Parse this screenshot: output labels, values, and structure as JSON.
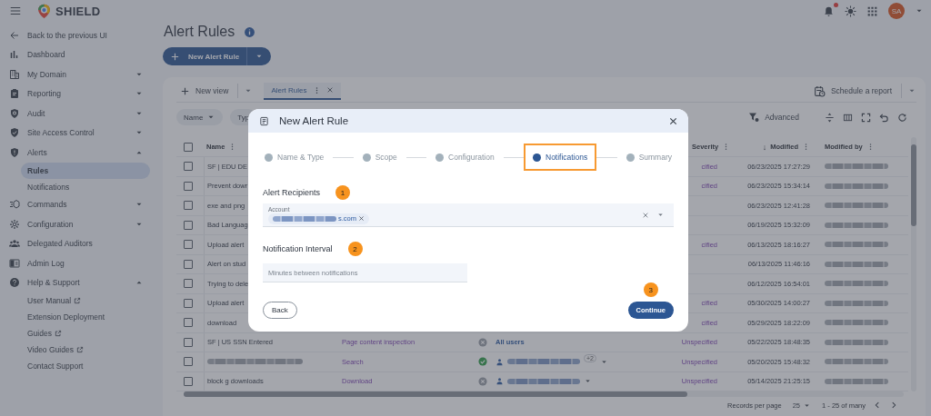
{
  "app": {
    "title": "SHIELD",
    "avatar": "SA"
  },
  "sidebar": {
    "items": [
      {
        "label": "Back to the previous UI",
        "kind": "back",
        "selected": false
      },
      {
        "label": "Dashboard",
        "kind": "link",
        "selected": false
      },
      {
        "label": "My Domain",
        "kind": "group",
        "selected": false,
        "expanded": false
      },
      {
        "label": "Reporting",
        "kind": "group",
        "selected": false,
        "expanded": false
      },
      {
        "label": "Audit",
        "kind": "group",
        "selected": false,
        "expanded": false
      },
      {
        "label": "Site Access Control",
        "kind": "group",
        "selected": false,
        "expanded": false
      },
      {
        "label": "Alerts",
        "kind": "group",
        "selected": false,
        "expanded": true,
        "children": [
          {
            "label": "Rules",
            "selected": true,
            "external": false
          },
          {
            "label": "Notifications",
            "selected": false,
            "external": false
          }
        ]
      },
      {
        "label": "Commands",
        "kind": "group",
        "selected": false,
        "expanded": false
      },
      {
        "label": "Configuration",
        "kind": "group",
        "selected": false,
        "expanded": false
      },
      {
        "label": "Delegated Auditors",
        "kind": "link",
        "selected": false
      },
      {
        "label": "Admin Log",
        "kind": "link",
        "selected": false
      },
      {
        "label": "Help & Support",
        "kind": "group",
        "selected": false,
        "expanded": true,
        "children": [
          {
            "label": "User Manual",
            "selected": false,
            "external": true
          },
          {
            "label": "Extension Deployment",
            "selected": false,
            "external": false
          },
          {
            "label": "Guides",
            "selected": false,
            "external": true
          },
          {
            "label": "Video Guides",
            "selected": false,
            "external": true
          },
          {
            "label": "Contact Support",
            "selected": false,
            "external": false
          }
        ]
      }
    ]
  },
  "page": {
    "title": "Alert Rules",
    "new_button": "New Alert Rule"
  },
  "views": {
    "new_view": "New view",
    "tabs": [
      {
        "label": "Alert Rules",
        "selected": true
      }
    ],
    "schedule": "Schedule a report"
  },
  "filters": {
    "chips": [
      "Name",
      "Typ"
    ],
    "advanced": "Advanced"
  },
  "table": {
    "select_all": {
      "checked": false
    },
    "columns": [
      {
        "label": "Name"
      },
      {
        "label": "Severity"
      },
      {
        "label": "Modified",
        "sort_arrow": "↓"
      },
      {
        "label": "Modified by"
      }
    ],
    "rows": [
      {
        "checked": false,
        "name": "SF | EDU DE",
        "severity": "cified",
        "modified": "06/23/2025 17:27:29"
      },
      {
        "checked": false,
        "name": "Prevent dowr",
        "severity": "cified",
        "modified": "06/23/2025 15:34:14"
      },
      {
        "checked": false,
        "name": "exe and png",
        "modified": "06/23/2025 12:41:28"
      },
      {
        "checked": false,
        "name": "Bad Languag",
        "modified": "06/19/2025 15:32:09"
      },
      {
        "checked": false,
        "name": "Upload alert",
        "severity": "cified",
        "modified": "06/13/2025 18:16:27"
      },
      {
        "checked": false,
        "name": "Alert on stud",
        "modified": "06/13/2025 11:46:16"
      },
      {
        "checked": false,
        "name": "Trying to dele",
        "modified": "06/12/2025 16:54:01"
      },
      {
        "checked": false,
        "name": "Upload alert",
        "severity": "cified",
        "modified": "05/30/2025 14:00:27"
      },
      {
        "checked": false,
        "name": "download",
        "severity": "cified",
        "modified": "05/29/2025 18:22:09"
      },
      {
        "checked": false,
        "name": "SF | US SSN Entered",
        "type": "Page content inspection",
        "enabled": false,
        "scope": "All users",
        "severity": "Unspecified",
        "modified": "05/22/2025 18:48:35"
      },
      {
        "checked": false,
        "name_blurred": true,
        "type": "Search",
        "enabled": true,
        "scope_blurred": true,
        "scope_extra": "+2",
        "severity": "Unspecified",
        "modified": "05/20/2025 15:48:32"
      },
      {
        "checked": false,
        "name": "block g downloads",
        "type": "Download",
        "enabled": false,
        "scope_blurred": true,
        "severity": "Unspecified",
        "modified": "05/14/2025 21:25:15"
      }
    ]
  },
  "pagination": {
    "label": "Records per page",
    "per_page": "25",
    "range": "1 - 25 of many"
  },
  "modal": {
    "title": "New Alert Rule",
    "steps": [
      {
        "label": "Name & Type",
        "selected": false,
        "highlighted": false
      },
      {
        "label": "Scope",
        "selected": false,
        "highlighted": false
      },
      {
        "label": "Configuration",
        "selected": false,
        "highlighted": false
      },
      {
        "label": "Notifications",
        "selected": true,
        "highlighted": true
      },
      {
        "label": "Summary",
        "selected": false,
        "highlighted": false
      }
    ],
    "sections": [
      {
        "kind": "recipients",
        "title": "Alert Recipients",
        "callout": "1",
        "label": "Account",
        "chips": [
          {
            "text": "s.com"
          }
        ]
      },
      {
        "kind": "interval",
        "title": "Notification Interval",
        "callout": "2",
        "placeholder": "Minutes between notifications"
      }
    ],
    "back": "Back",
    "continue": {
      "label": "Continue",
      "callout": "3"
    }
  }
}
